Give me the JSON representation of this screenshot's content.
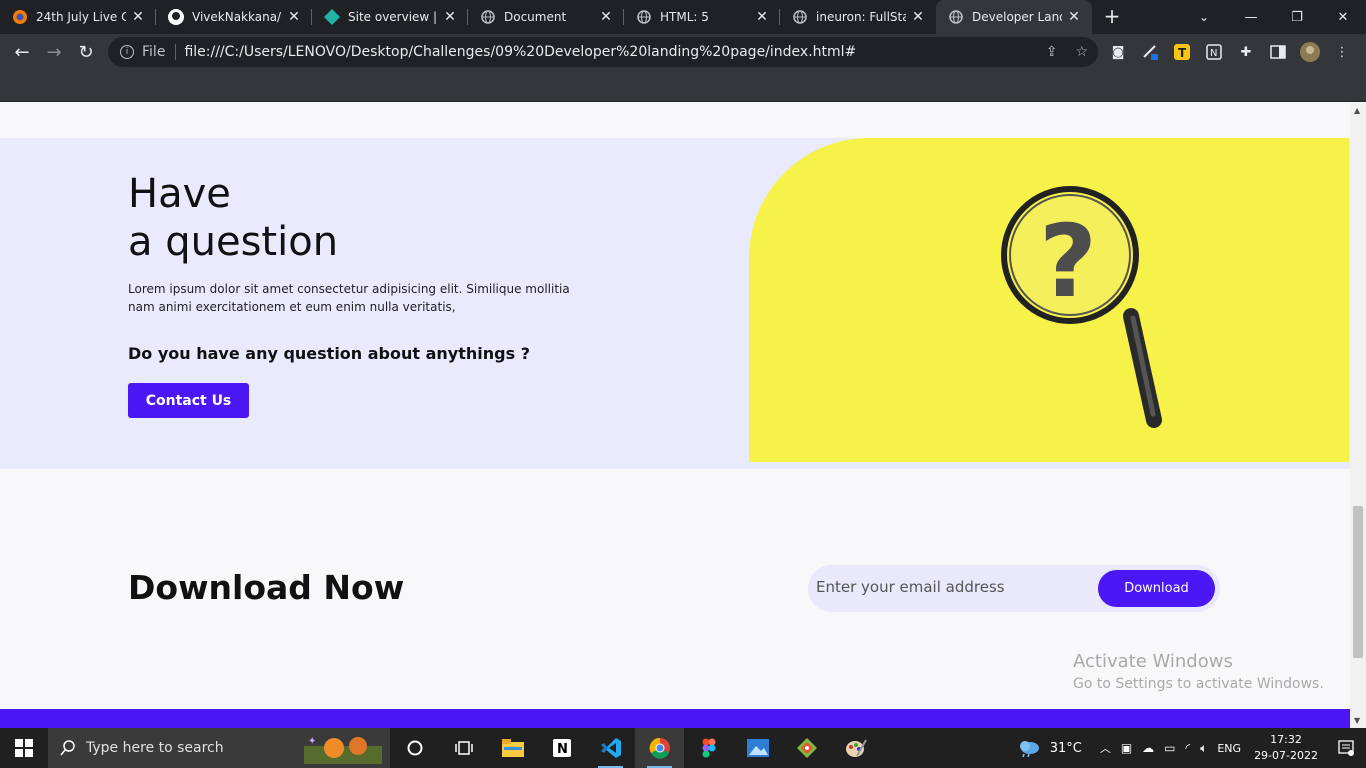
{
  "browser": {
    "tabs": [
      {
        "title": "24th July Live Cla",
        "icon": "ineuron-orange-icon"
      },
      {
        "title": "VivekNakkana/01",
        "icon": "github-icon"
      },
      {
        "title": "Site overview | int",
        "icon": "netlify-icon"
      },
      {
        "title": "Document",
        "icon": "globe-icon"
      },
      {
        "title": "HTML: 5",
        "icon": "globe-icon"
      },
      {
        "title": "ineuron: FullStack",
        "icon": "globe-icon"
      },
      {
        "title": "Developer Landin",
        "icon": "globe-icon",
        "active": true
      }
    ],
    "new_tab": "+",
    "address": {
      "scheme_label": "File",
      "url": "file:///C:/Users/LENOVO/Desktop/Challenges/09%20Developer%20landing%20page/index.html#"
    }
  },
  "page": {
    "question": {
      "title_line1": "Have",
      "title_line2": "a question",
      "text": "Lorem ipsum dolor sit amet consectetur adipisicing elit. Similique mollitia nam animi exercitationem et eum enim nulla veritatis,",
      "subheading": "Do you have any question about anythings ?",
      "contact_label": "Contact Us",
      "image_bg": "#f6f24a"
    },
    "download": {
      "title_bold": "Download",
      "title_rest": "Now",
      "email_placeholder": "Enter your email address",
      "button_label": "Download"
    },
    "accent": "#4b17f5",
    "watermark": {
      "line1": "Activate Windows",
      "line2": "Go to Settings to activate Windows."
    }
  },
  "taskbar": {
    "search_placeholder": "Type here to search",
    "weather": "31°C",
    "language": "ENG",
    "time": "17:32",
    "date": "29-07-2022"
  }
}
